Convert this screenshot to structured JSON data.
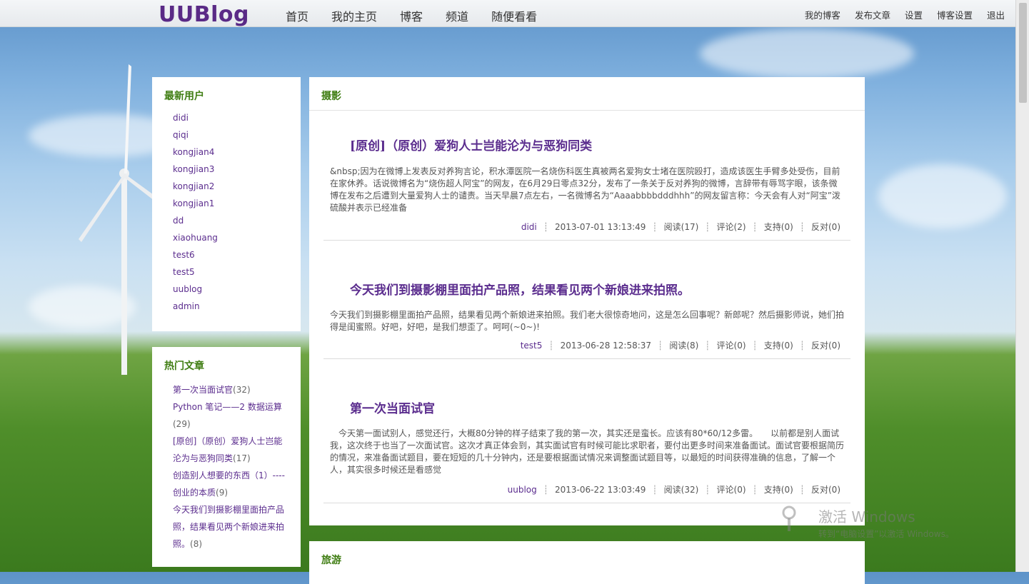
{
  "header": {
    "logo": "UUBlog",
    "nav": [
      "首页",
      "我的主页",
      "博客",
      "频道",
      "随便看看"
    ],
    "user_nav": [
      "我的博客",
      "发布文章",
      "设置",
      "博客设置",
      "退出"
    ]
  },
  "sidebar": {
    "new_users_title": "最新用户",
    "new_users": [
      "didi",
      "qiqi",
      "kongjian4",
      "kongjian3",
      "kongjian2",
      "kongjian1",
      "dd",
      "xiaohuang",
      "test6",
      "test5",
      "uublog",
      "admin"
    ],
    "hot_title": "热门文章",
    "hot_articles": [
      {
        "title": "第一次当面试官",
        "count": "(32)"
      },
      {
        "title": "Python 笔记——2 数据运算",
        "count": "(29)"
      },
      {
        "title": "[原创]（原创）爱狗人士岂能沦为与恶狗同类",
        "count": "(17)"
      },
      {
        "title": "创造别人想要的东西（1）----创业的本质",
        "count": "(9)"
      },
      {
        "title": "今天我们到摄影棚里面拍产品照，结果看见两个新娘进来拍照。",
        "count": "(8)"
      }
    ]
  },
  "main": {
    "category": "摄影",
    "posts": [
      {
        "title": "[原创]（原创）爱狗人士岂能沦为与恶狗同类",
        "body": "&nbsp;因为在微博上发表反对养狗言论，积水潭医院一名烧伤科医生真被两名爱狗女士堵在医院殴打，造成该医生手臂多处受伤，目前在家休养。话说微博名为“烧伤超人阿宝”的网友，在6月29日零点32分，发布了一条关于反对养狗的微博，言辞带有辱骂字眼，该条微博在发布之后遭到大量爱狗人士的谴责。当天早晨7点左右，一名微博名为“Aaaabbbbdddhhh”的网友留言称：今天会有人对“阿宝”泼硫酸并表示已经准备",
        "author": "didi",
        "time": "2013-07-01 13:13:49",
        "read": "阅读(17)",
        "comment": "评论(2)",
        "support": "支持(0)",
        "oppose": "反对(0)"
      },
      {
        "title": "今天我们到摄影棚里面拍产品照，结果看见两个新娘进来拍照。",
        "body": "今天我们到摄影棚里面拍产品照，结果看见两个新娘进来拍照。我们老大很惊奇地问，这是怎么回事呢？新郎呢？然后摄影师说，她们拍得是闺蜜照。好吧，好吧，是我们想歪了。呵呵(~0~)!",
        "author": "test5",
        "time": "2013-06-28 12:58:37",
        "read": "阅读(8)",
        "comment": "评论(0)",
        "support": "支持(0)",
        "oppose": "反对(0)"
      },
      {
        "title": "第一次当面试官",
        "body": "　今天第一面试别人，感觉还行，大概80分钟的样子结束了我的第一次，其实还是蛮长。应该有80*60/12多雷。　　以前都是别人面试我，这次终于也当了一次面试官。这次才真正体会到，其实面试官有时候可能比求职者，要付出更多时间来准备面试。面试官要根据简历的情况，来准备面试题目，要在短短的几十分钟内，还是要根据面试情况来调整面试题目等，以最短的时间获得准确的信息，了解一个人，其实很多时候还是看感觉",
        "author": "uublog",
        "time": "2013-06-22 13:03:49",
        "read": "阅读(32)",
        "comment": "评论(0)",
        "support": "支持(0)",
        "oppose": "反对(0)"
      }
    ],
    "next_category": "旅游"
  },
  "watermark": {
    "line1": "激活 Windows",
    "line2": "转到“电脑设置”以激活 Windows。"
  }
}
